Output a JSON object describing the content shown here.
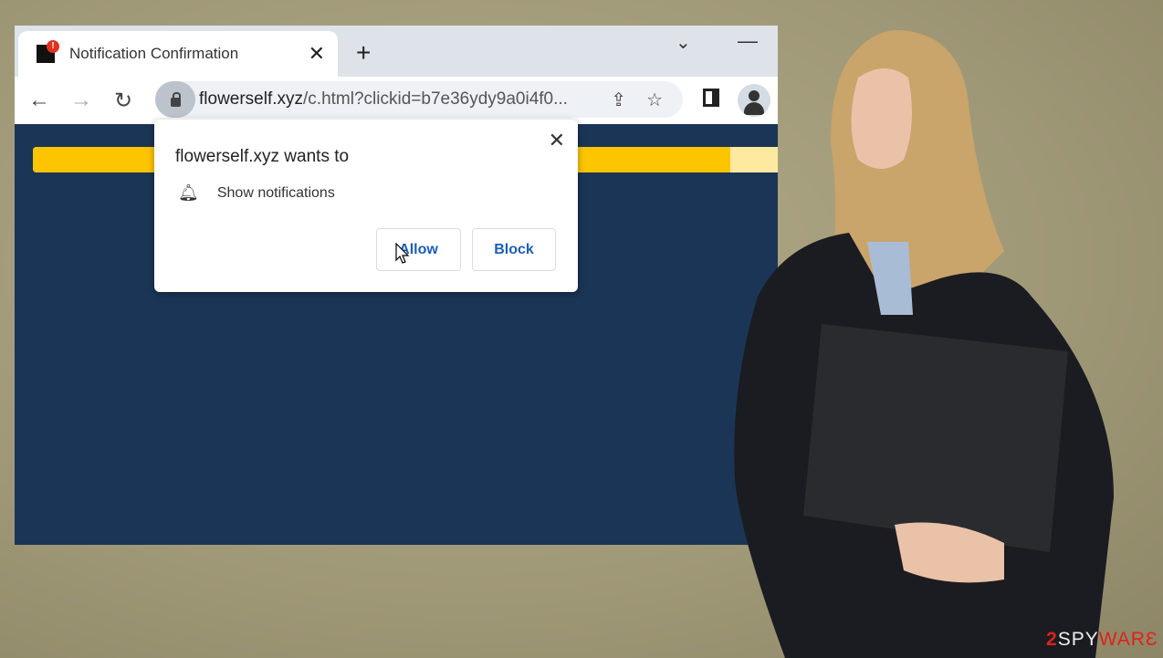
{
  "browser": {
    "tab": {
      "title": "Notification Confirmation",
      "badge": "!",
      "close": "✕"
    },
    "new_tab": "+",
    "chevron": "⌄",
    "minimize": "—",
    "nav": {
      "back": "←",
      "forward": "→",
      "reload": "↻"
    },
    "url": {
      "domain": "flowerself.xyz",
      "rest": "/c.html?clickid=b7e36ydy9a0i4f0..."
    },
    "share": "⇪",
    "star": "☆"
  },
  "page": {
    "progress_percent": 92,
    "colors": {
      "background": "#1b3556",
      "bar_fill": "#fdc500",
      "bar_track": "#fde9a0"
    }
  },
  "popup": {
    "title": "flowerself.xyz wants to",
    "close": "✕",
    "permission": "Show notifications",
    "bell": "🔔",
    "allow": "Allow",
    "block": "Block"
  },
  "watermark": {
    "a": "2",
    "b": "SPY",
    "c": "WAR",
    "d": "Ɛ"
  }
}
